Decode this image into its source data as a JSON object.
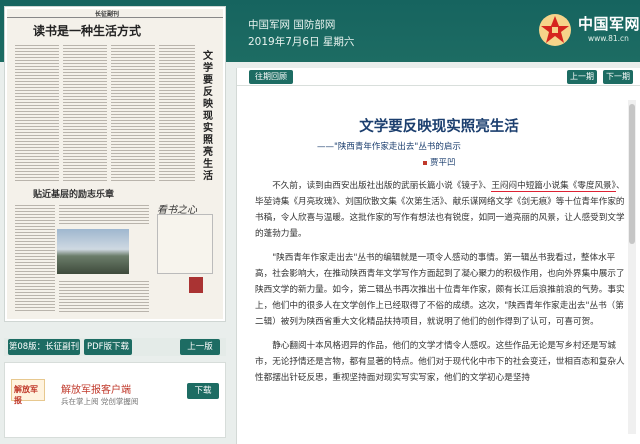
{
  "header": {
    "site": "中国军网 国防部网",
    "date": "2019年7月6日 星期六",
    "logo_text": "中国军网",
    "logo_url": "www.81.cn"
  },
  "newspaper": {
    "section_name": "长征副刊",
    "headline_main": "读书是一种生活方式",
    "headline_vertical": "文学要反映现实照亮生活",
    "headline_lower": "贴近基层的励志乐章",
    "calligraphy_title": "看书之心"
  },
  "page_controls": {
    "current_page": "第08版：长征副刊",
    "pdf_download": "PDF版下载",
    "prev_page": "上一版"
  },
  "app": {
    "logo_label": "解放军报",
    "title": "解放军报客户端",
    "subtitle": "兵在掌上阅 党创掌握阅",
    "download": "下载"
  },
  "article_nav": {
    "back": "往期回顾",
    "prev": "上一期",
    "next": "下一期"
  },
  "article": {
    "title": "文学要反映现实照亮生活",
    "subtitle": "——\"陕西青年作家走出去\"丛书的启示",
    "author": "贾平凹",
    "p1_a": "不久前，读到由西安出版社出版的武丽长篇小说《镜子》、",
    "p1_hl": "王闷闷中短篇小说集《零度风景》",
    "p1_b": "、毕堃诗集《月亮玫瑰》、刘国欣散文集《次第生活》、献乐谋网络文学《剑无痕》等十位青年作家的书稿，令人欣喜与温暖。这批作家的写作有想法也有锐度，如同一道亮丽的风景，让人感受到文学的蓬勃力量。",
    "p2": "\"陕西青年作家走出去\"丛书的编辑就是一项令人感动的事情。第一辑丛书我看过，整体水平高，社会影响大，在推动陕西青年文学写作方面起到了凝心聚力的积极作用，也向外界集中展示了陕西文学的新力量。如今，第二辑丛书再次推出十位青年作家，颇有长江后浪推前浪的气势。事实上，他们中的很多人在文学创作上已经取得了不俗的成绩。这次，\"陕西青年作家走出去\"丛书（第二辑）被列为陕西省重大文化精品扶持项目，就说明了他们的创作得到了认可，可喜可贺。",
    "p3": "静心翻阅十本风格迥异的作品，他们的文学才情令人感叹。这些作品无论是写乡村还是写城市，无论抒情还是言物，都有显著的特点。他们对于现代化中市下的社会变迁，世相百态和复杂人性都摆出针砭反思，重视坚持面对现实写实写家，他们的文学初心是坚持"
  }
}
